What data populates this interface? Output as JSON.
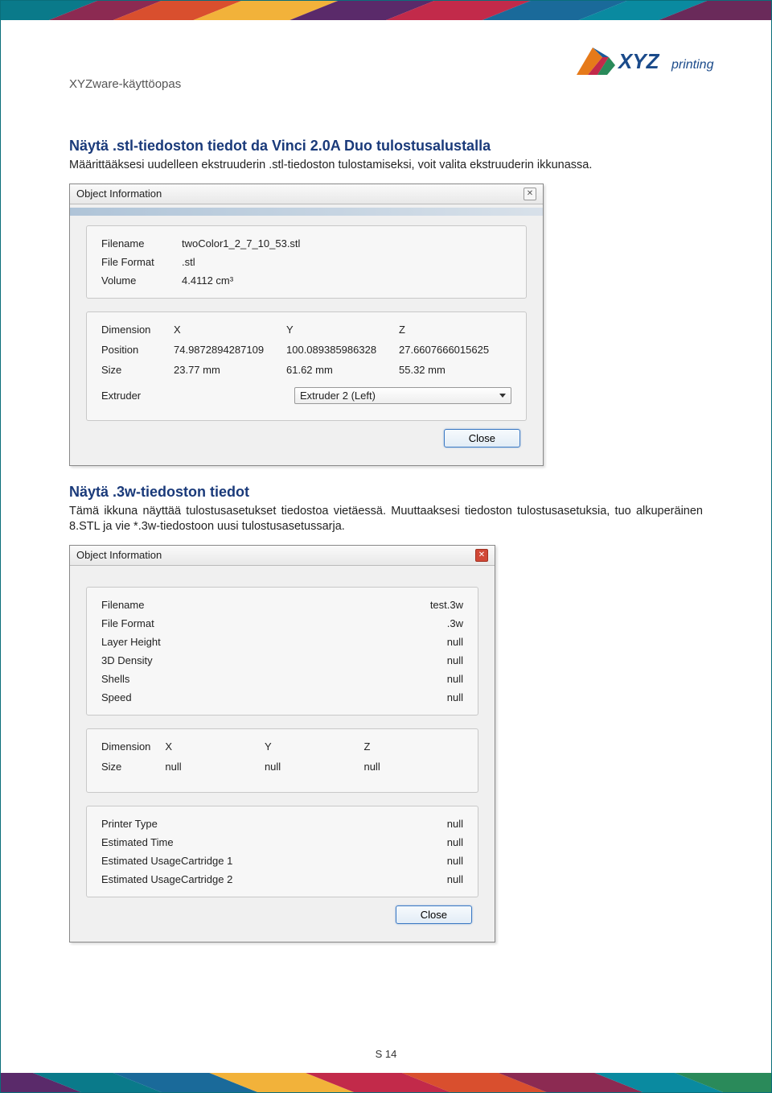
{
  "header": {
    "doc_title": "XYZware-käyttöopas"
  },
  "logo": {
    "text": "XYZprinting"
  },
  "section1": {
    "heading": "Näytä .stl-tiedoston tiedot da Vinci 2.0A Duo tulostusalustalla",
    "body": "Määrittääksesi uudelleen ekstruuderin .stl-tiedoston tulostamiseksi, voit valita ekstruuderin ikkunassa."
  },
  "dialog1": {
    "title": "Object Information",
    "panel1": {
      "filename_label": "Filename",
      "filename_value": "twoColor1_2_7_10_53.stl",
      "format_label": "File Format",
      "format_value": ".stl",
      "volume_label": "Volume",
      "volume_value": "4.4112 cm³"
    },
    "panel2": {
      "dimension_label": "Dimension",
      "x": "X",
      "y": "Y",
      "z": "Z",
      "position_label": "Position",
      "pos_x": "74.9872894287109",
      "pos_y": "100.089385986328",
      "pos_z": "27.6607666015625",
      "size_label": "Size",
      "size_x": "23.77 mm",
      "size_y": "61.62 mm",
      "size_z": "55.32 mm",
      "extruder_label": "Extruder",
      "extruder_value": "Extruder 2 (Left)"
    },
    "close_btn": "Close"
  },
  "section2": {
    "heading": "Näytä .3w-tiedoston tiedot",
    "body": "Tämä ikkuna näyttää tulostusasetukset tiedostoa vietäessä. Muuttaaksesi tiedoston tulostusasetuksia, tuo alkuperäinen 8.STL ja vie *.3w-tiedostoon uusi tulostusasetussarja."
  },
  "dialog2": {
    "title": "Object Information",
    "panel1": {
      "rows": [
        {
          "label": "Filename",
          "value": "test.3w"
        },
        {
          "label": "File Format",
          "value": ".3w"
        },
        {
          "label": "Layer Height",
          "value": "null"
        },
        {
          "label": "3D Density",
          "value": "null"
        },
        {
          "label": "Shells",
          "value": "null"
        },
        {
          "label": "Speed",
          "value": "null"
        }
      ]
    },
    "panel2": {
      "dimension_label": "Dimension",
      "x": "X",
      "y": "Y",
      "z": "Z",
      "size_label": "Size",
      "sx": "null",
      "sy": "null",
      "sz": "null"
    },
    "panel3": {
      "rows": [
        {
          "label": "Printer Type",
          "value": "null"
        },
        {
          "label": "Estimated Time",
          "value": "null"
        },
        {
          "label": "Estimated UsageCartridge 1",
          "value": "null"
        },
        {
          "label": "Estimated UsageCartridge 2",
          "value": "null"
        }
      ]
    },
    "close_btn": "Close"
  },
  "page_number": "S 14"
}
